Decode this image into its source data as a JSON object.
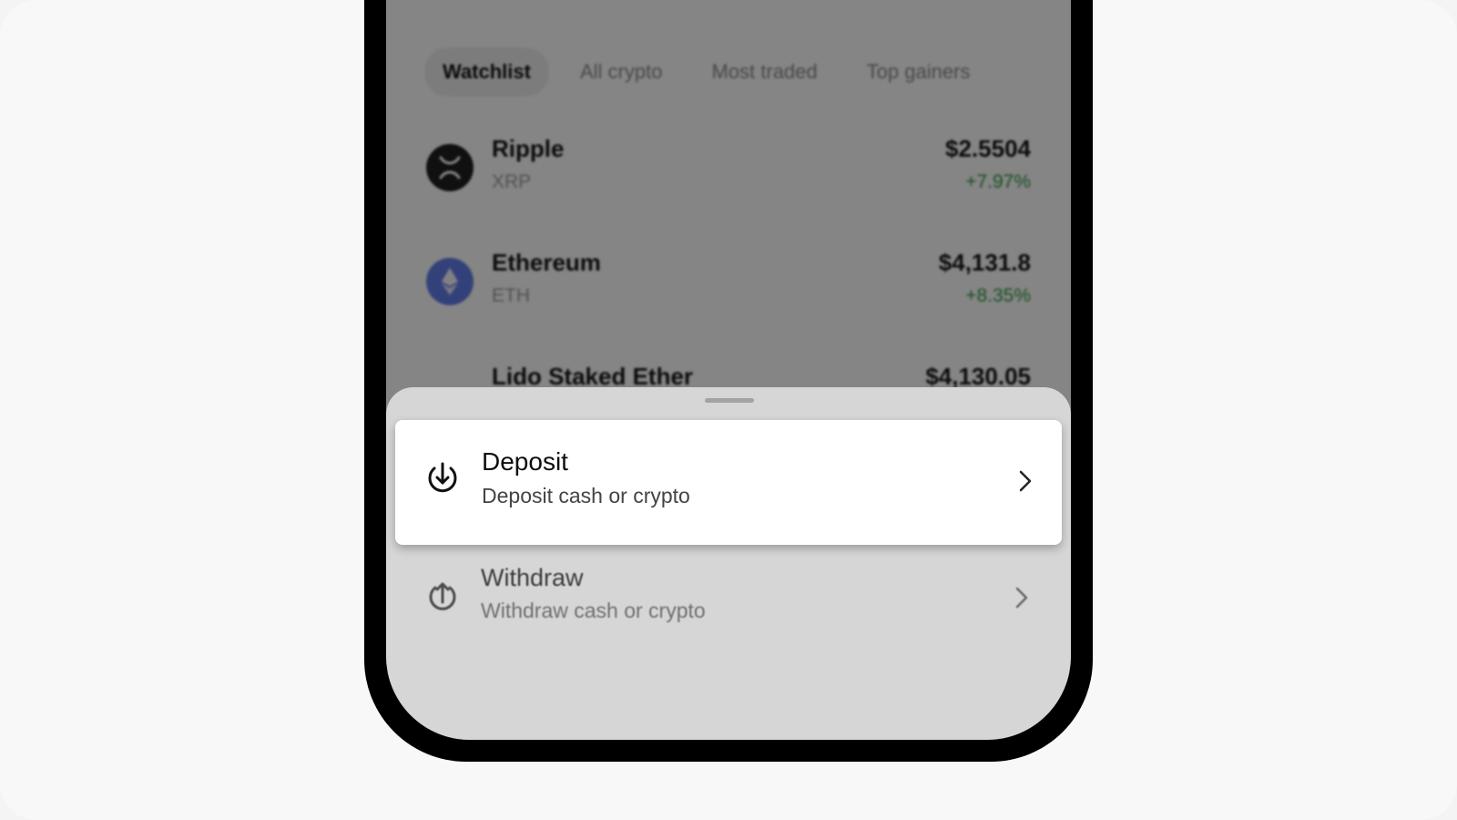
{
  "tabs": [
    {
      "label": "Watchlist",
      "active": true
    },
    {
      "label": "All crypto",
      "active": false
    },
    {
      "label": "Most traded",
      "active": false
    },
    {
      "label": "Top gainers",
      "active": false
    }
  ],
  "assets": [
    {
      "name": "Ripple",
      "symbol": "XRP",
      "price": "$2.5504",
      "change": "+7.97%",
      "icon": "xrp-icon",
      "icon_color": "#1f1f1f"
    },
    {
      "name": "Ethereum",
      "symbol": "ETH",
      "price": "$4,131.8",
      "change": "+8.35%",
      "icon": "ethereum-icon",
      "icon_color": "#627eea"
    },
    {
      "name": "Lido Staked Ether",
      "symbol": "",
      "price": "$4,130.05",
      "change": "",
      "icon": "lido-icon",
      "icon_color": "#4aa3df"
    }
  ],
  "sheet": {
    "options": [
      {
        "title": "Deposit",
        "subtitle": "Deposit cash or crypto",
        "icon": "deposit-icon",
        "highlighted": true
      },
      {
        "title": "Withdraw",
        "subtitle": "Withdraw cash or crypto",
        "icon": "withdraw-icon",
        "highlighted": false
      }
    ]
  },
  "colors": {
    "positive": "#2c9a3c",
    "ethereum": "#627eea",
    "overlay": "rgba(0,0,0,0.48)"
  }
}
